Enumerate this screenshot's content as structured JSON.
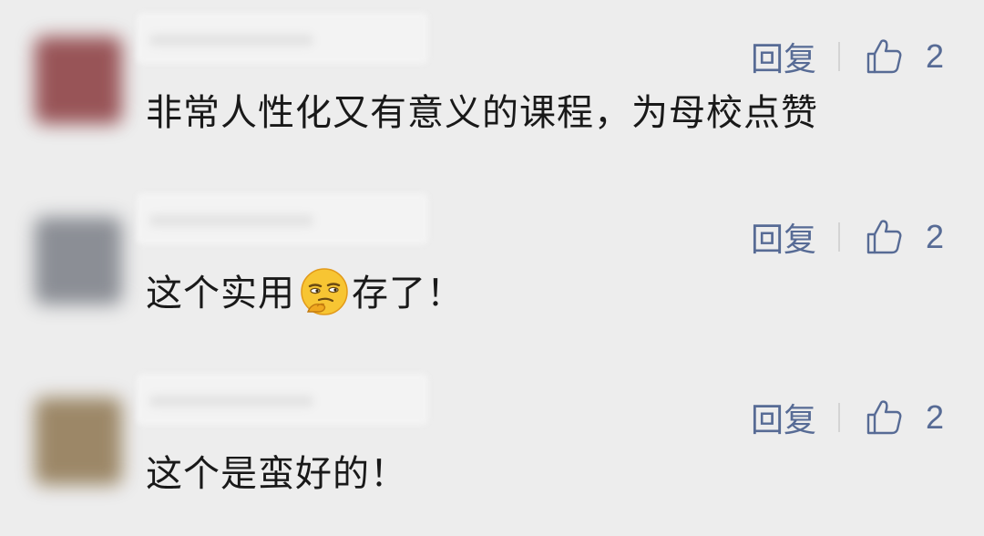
{
  "colors": {
    "background": "#ededed",
    "link": "#576b95",
    "text": "#191919"
  },
  "comments": [
    {
      "text": "非常人性化又有意义的课程，为母校点赞",
      "reply_label": "回复",
      "likes": "2",
      "avatar_color": "#8a3a3e"
    },
    {
      "text_before_emoji": "这个实用",
      "emoji_icon": "smirk-thinking-emoji",
      "text_after_emoji": "存了！",
      "reply_label": "回复",
      "likes": "2",
      "avatar_color": "#7a7e86"
    },
    {
      "text": "这个是蛮好的！",
      "reply_label": "回复",
      "likes": "2",
      "avatar_color": "#8e7650"
    }
  ]
}
